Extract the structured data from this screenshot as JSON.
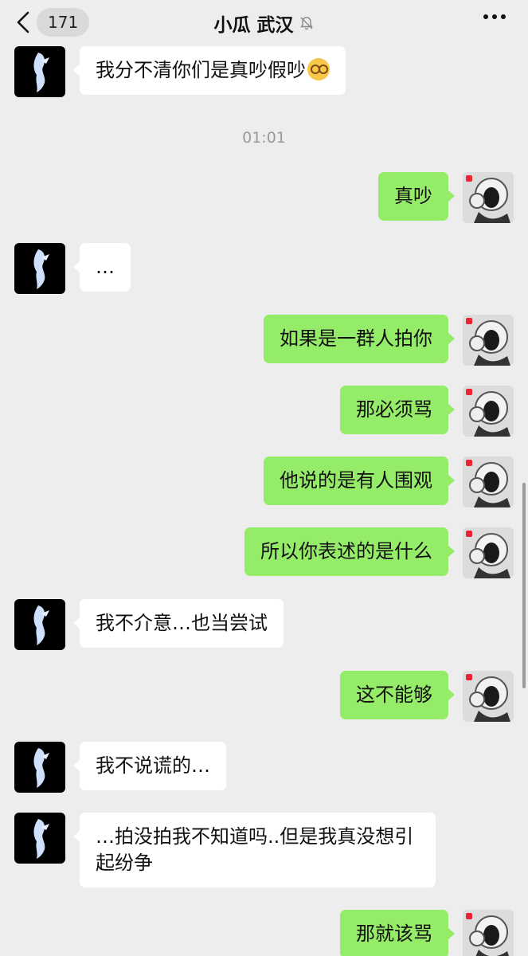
{
  "header": {
    "back_count": "171",
    "title": "小瓜 武汉",
    "muted_icon": "bell-mute-icon",
    "more_icon": "more-dots-icon"
  },
  "timestamp": "01:01",
  "messages": [
    {
      "side": "left",
      "text": "我分不清你们是真吵假吵",
      "emoji": "dizzy-face"
    },
    {
      "side": "right",
      "text": "真吵"
    },
    {
      "side": "left",
      "text": "…"
    },
    {
      "side": "right",
      "text": "如果是一群人拍你"
    },
    {
      "side": "right",
      "text": "那必须骂"
    },
    {
      "side": "right",
      "text": "他说的是有人围观"
    },
    {
      "side": "right",
      "text": "所以你表述的是什么"
    },
    {
      "side": "left",
      "text": "我不介意…也当尝试"
    },
    {
      "side": "right",
      "text": "这不能够"
    },
    {
      "side": "left",
      "text": "我不说谎的…"
    },
    {
      "side": "left",
      "text": "…拍没拍我不知道吗..但是我真没想引起纷争"
    },
    {
      "side": "right",
      "text": "那就该骂"
    }
  ],
  "colors": {
    "background": "#ededed",
    "sent_bubble": "#95ec69",
    "received_bubble": "#ffffff"
  }
}
